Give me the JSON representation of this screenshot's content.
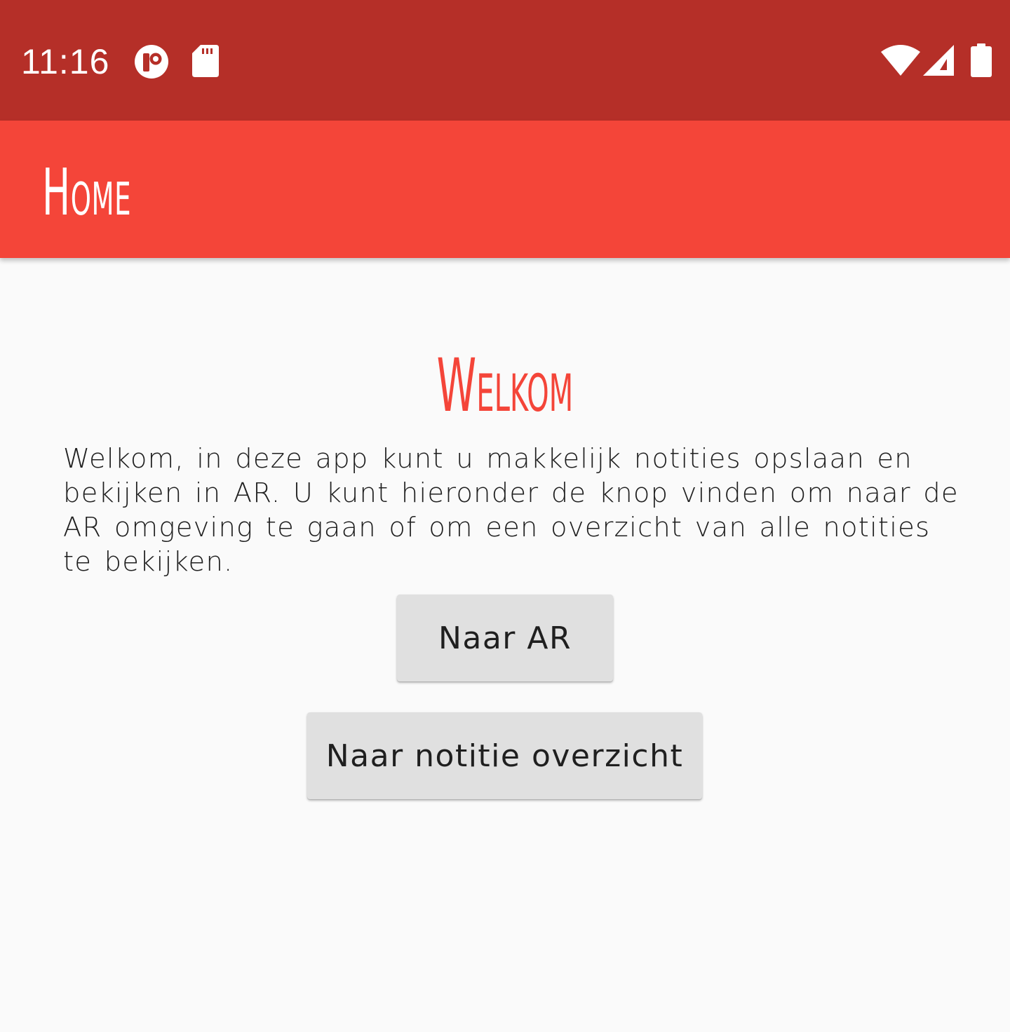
{
  "status_bar": {
    "time": "11:16",
    "icons": [
      "app-notification-icon",
      "sd-card-icon",
      "wifi-icon",
      "signal-icon",
      "battery-icon"
    ]
  },
  "app_bar": {
    "title": "Home"
  },
  "main": {
    "heading": "Welkom",
    "intro": "Welkom, in deze app kunt u makkelijk notities opslaan en bekijken in AR. U kunt hieronder de knop vinden om naar de AR omgeving te gaan of om een overzicht van alle notities te bekijken.",
    "ar_button_label": "Naar AR",
    "overview_button_label": "Naar notitie overzicht"
  },
  "colors": {
    "status_bar": "#b52f28",
    "app_bar": "#f44539",
    "accent": "#f44539",
    "background": "#fafafa",
    "button": "#e0e0e0"
  }
}
